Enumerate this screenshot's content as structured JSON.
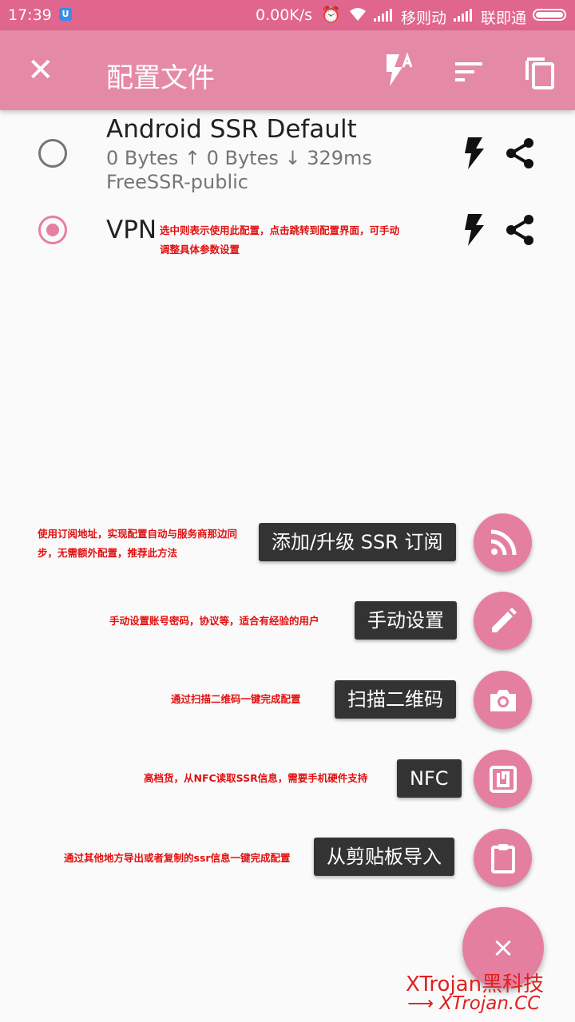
{
  "status_bar": {
    "time": "17:39",
    "app_icon": "U",
    "speed": "0.00K/s",
    "carrier1": "移则动",
    "carrier2": "联即通"
  },
  "toolbar": {
    "title": "配置文件"
  },
  "profiles": [
    {
      "name": "Android SSR Default",
      "stats": "0 Bytes ↑  0 Bytes ↓  329ms",
      "group": "FreeSSR-public",
      "selected": false
    },
    {
      "name": "VPN",
      "selected": true
    }
  ],
  "annotations": {
    "vpn_note_line1": "选中则表示使用此配置，点击跳转到配置界面，可手动",
    "vpn_note_line2": "调整具体参数设置",
    "subscription_note_line1": "使用订阅地址，实现配置自动与服务商那边同",
    "subscription_note_line2": "步，无需额外配置，推荐此方法",
    "manual_note": "手动设置账号密码，协议等，适合有经验的用户",
    "qr_note": "通过扫描二维码一键完成配置",
    "nfc_note": "高档货，从NFC读取SSR信息，需要手机硬件支持",
    "clipboard_note": "通过其他地方导出或者复制的ssr信息一键完成配置"
  },
  "fab_menu": {
    "subscription": "添加/升级 SSR 订阅",
    "manual": "手动设置",
    "scan_qr": "扫描二维码",
    "nfc": "NFC",
    "clipboard": "从剪贴板导入",
    "close_symbol": "×"
  },
  "watermark": {
    "line1": "XTrojan黑科技",
    "line2": "XTrojan.CC"
  },
  "colors": {
    "status_bar": "#e0668d",
    "toolbar": "#e58aa6",
    "accent": "#e57fa0",
    "annotation": "#e01010"
  }
}
